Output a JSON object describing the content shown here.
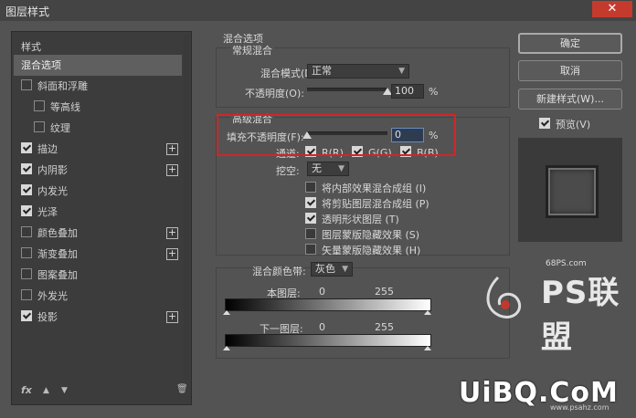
{
  "window": {
    "title": "图层样式",
    "close_glyph": "✕"
  },
  "left_panel": {
    "header": "样式",
    "items": [
      {
        "label": "混合选项",
        "checkbox": null,
        "selected": true,
        "plus": false
      },
      {
        "label": "斜面和浮雕",
        "checkbox": false,
        "selected": false,
        "plus": false
      },
      {
        "label": "等高线",
        "checkbox": false,
        "sub": true,
        "plus": false
      },
      {
        "label": "纹理",
        "checkbox": false,
        "sub": true,
        "plus": false
      },
      {
        "label": "描边",
        "checkbox": true,
        "plus": true
      },
      {
        "label": "内阴影",
        "checkbox": true,
        "plus": true
      },
      {
        "label": "内发光",
        "checkbox": true,
        "plus": false
      },
      {
        "label": "光泽",
        "checkbox": true,
        "plus": false
      },
      {
        "label": "颜色叠加",
        "checkbox": false,
        "plus": true
      },
      {
        "label": "渐变叠加",
        "checkbox": false,
        "plus": true
      },
      {
        "label": "图案叠加",
        "checkbox": false,
        "plus": false
      },
      {
        "label": "外发光",
        "checkbox": false,
        "plus": false
      },
      {
        "label": "投影",
        "checkbox": true,
        "plus": true
      }
    ],
    "fx_label": "fx",
    "up_glyph": "▲",
    "down_glyph": "▼",
    "trash_glyph": "🗑"
  },
  "blend_options": {
    "section_title": "混合选项",
    "general": {
      "title": "常规混合",
      "mode_label": "混合模式(D):",
      "mode_value": "正常",
      "opacity_label": "不透明度(O):",
      "opacity_value": "100",
      "opacity_unit": "%",
      "opacity_level": 1.0
    },
    "advanced": {
      "title": "高级混合",
      "fill_label": "填充不透明度(F):",
      "fill_value": "0",
      "fill_unit": "%",
      "fill_level": 0.0,
      "channels_label": "通道:",
      "channels": [
        {
          "label": "R(R)",
          "checked": true
        },
        {
          "label": "G(G)",
          "checked": true
        },
        {
          "label": "B(B)",
          "checked": true
        }
      ],
      "knockout_label": "挖空:",
      "knockout_value": "无",
      "options": [
        {
          "label": "将内部效果混合成组 (I)",
          "checked": false
        },
        {
          "label": "将剪贴图层混合成组 (P)",
          "checked": true
        },
        {
          "label": "透明形状图层 (T)",
          "checked": true
        },
        {
          "label": "图层蒙版隐藏效果 (S)",
          "checked": false
        },
        {
          "label": "矢量蒙版隐藏效果 (H)",
          "checked": false
        }
      ]
    },
    "blend_if": {
      "label": "混合颜色带:",
      "value": "灰色",
      "this_layer_label": "本图层:",
      "this_layer_min": "0",
      "this_layer_max": "255",
      "underlying_label": "下一图层:",
      "underlying_min": "0",
      "underlying_max": "255"
    }
  },
  "buttons": {
    "ok": "确定",
    "cancel": "取消",
    "new_style": "新建样式(W)...",
    "preview_label": "预览(V)",
    "preview_checked": true
  },
  "watermarks": {
    "site": "68PS.com",
    "ps_brand": "PS联盟",
    "uibq": "UiBQ.CoM",
    "url": "www.psahz.com"
  },
  "colors": {
    "highlight_box": "#d62424",
    "window_bg": "#535353",
    "panel_bg": "#3c3c3c"
  }
}
